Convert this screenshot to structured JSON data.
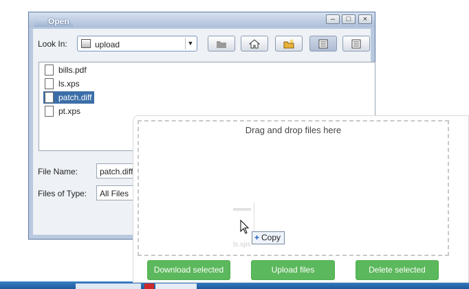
{
  "dialog": {
    "title": "Open",
    "window_buttons": {
      "minimize": "–",
      "maximize": "□",
      "close": "×"
    },
    "look_in": {
      "label": "Look In:",
      "value": "upload"
    },
    "toolbar_icons": [
      "up-folder-icon",
      "home-icon",
      "new-folder-icon",
      "list-view-icon",
      "details-view-icon"
    ],
    "files": [
      {
        "name": "bills.pdf",
        "selected": false
      },
      {
        "name": "ls.xps",
        "selected": false
      },
      {
        "name": "patch.diff",
        "selected": true
      },
      {
        "name": "pt.xps",
        "selected": false
      }
    ],
    "file_name": {
      "label": "File Name:",
      "value": "patch.diff"
    },
    "files_of_type": {
      "label": "Files of Type:",
      "value": "All Files"
    }
  },
  "upload": {
    "drop_text": "Drag and drop files here",
    "drag_ghost_label": "ls.xps",
    "copy_tooltip": "Copy",
    "buttons": {
      "download": "Download selected",
      "upload": "Upload files",
      "delete": "Delete selected"
    }
  },
  "colors": {
    "button_green": "#5cb85c",
    "selection_blue": "#3b6ea8",
    "dialog_frame": "#b9c9df"
  }
}
